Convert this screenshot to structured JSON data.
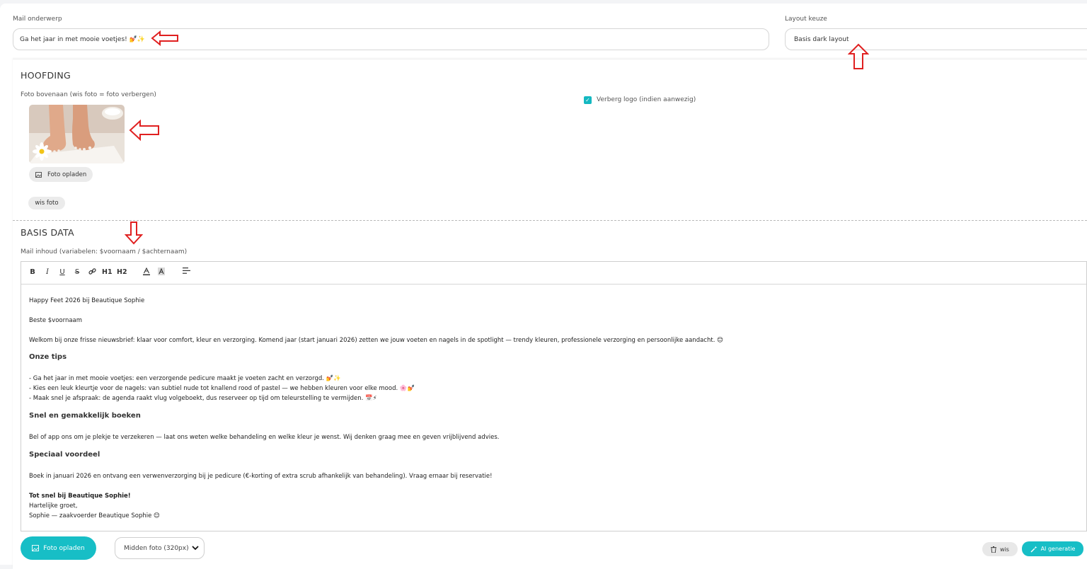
{
  "subject": {
    "label": "Mail onderwerp",
    "value": "Ga het jaar in met mooie voetjes! 💅✨"
  },
  "layout": {
    "label": "Layout keuze",
    "value": "Basis dark layout"
  },
  "header_section": {
    "title": "HOOFDING",
    "photo_label": "Foto bovenaan (wis foto = foto verbergen)",
    "upload_label": "Foto opladen",
    "clear_label": "wis foto",
    "hide_logo_label": "Verberg logo (indien aanwezig)",
    "hide_logo_checked": true
  },
  "basis_section": {
    "title": "BASIS DATA",
    "content_label": "Mail inhoud (variabelen: $voornaam / $achternaam)"
  },
  "editor": {
    "toolbar": [
      "B",
      "I",
      "U",
      "S",
      "link",
      "H1",
      "H2",
      "text-color",
      "highlight",
      "align"
    ],
    "lines": {
      "l1": "Happy Feet 2026 bij Beautique Sophie",
      "l2": "Beste $voornaam",
      "l3": "Welkom bij onze frisse nieuwsbrief: klaar voor comfort, kleur en verzorging. Komend jaar (start januari 2026) zetten we jouw voeten en nagels in de spotlight — trendy kleuren, professionele verzorging en persoonlijke aandacht. 😊",
      "h1": "Onze tips",
      "t1": "- Ga het jaar in met mooie voetjes: een verzorgende pedicure maakt je voeten zacht en verzorgd. 💅✨",
      "t2": "- Kies een leuk kleurtje voor de nagels: van subtiel nude tot knallend rood of pastel — we hebben kleuren voor elke mood. 🌸💅",
      "t3": "- Maak snel je afspraak: de agenda raakt vlug volgeboekt, dus reserveer op tijd om teleurstelling te vermijden. 📅⚡",
      "h2": "Snel en gemakkelijk boeken",
      "l4": "Bel of app ons om je plekje te verzekeren — laat ons weten welke behandeling en welke kleur je wenst. Wij denken graag mee en geven vrijblijvend advies.",
      "h3": "Speciaal voordeel",
      "l5": "Boek in januari 2026 en ontvang een verwenverzorging bij je pedicure (€-korting of extra scrub afhankelijk van behandeling). Vraag ernaar bij reservatie!",
      "l6": "Tot snel bij Beautique Sophie!",
      "l7": "Hartelijke groet,",
      "l8": "Sophie — zaakvoerder Beautique Sophie 😊"
    }
  },
  "footer": {
    "upload_label": "Foto opladen",
    "size_select": "Midden foto (320px)",
    "clear_label": "wis",
    "ai_label": "AI generatie"
  },
  "colors": {
    "accent": "#17bec6",
    "annotation_arrow": "#e02020"
  }
}
